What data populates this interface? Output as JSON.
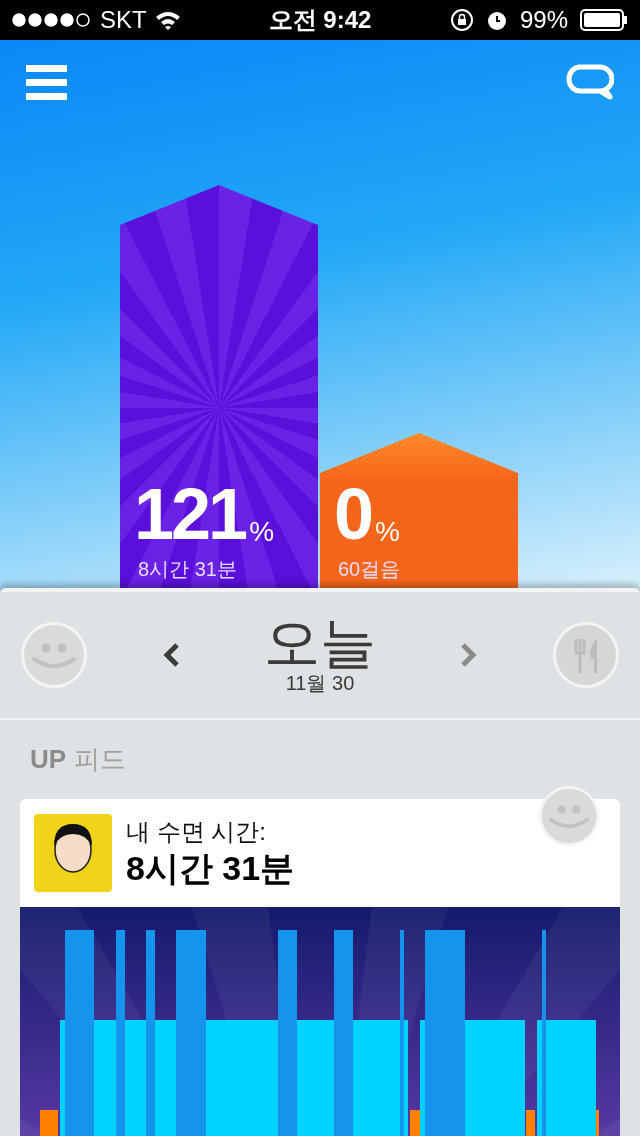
{
  "status_bar": {
    "carrier": "SKT",
    "time": "오전 9:42",
    "battery": "99%"
  },
  "goals": [
    {
      "kind": "sleep",
      "percent": "121",
      "unit": "%",
      "detail": "8시간 31분"
    },
    {
      "kind": "steps",
      "percent": "0",
      "unit": "%",
      "detail": "60걸음"
    }
  ],
  "day_nav": {
    "title": "오늘",
    "date": "11월 30"
  },
  "feed": {
    "brand": "UP",
    "title": "피드",
    "cards": [
      {
        "kind": "sleep",
        "label": "내 수면 시간:",
        "value": "8시간 31분"
      }
    ]
  }
}
